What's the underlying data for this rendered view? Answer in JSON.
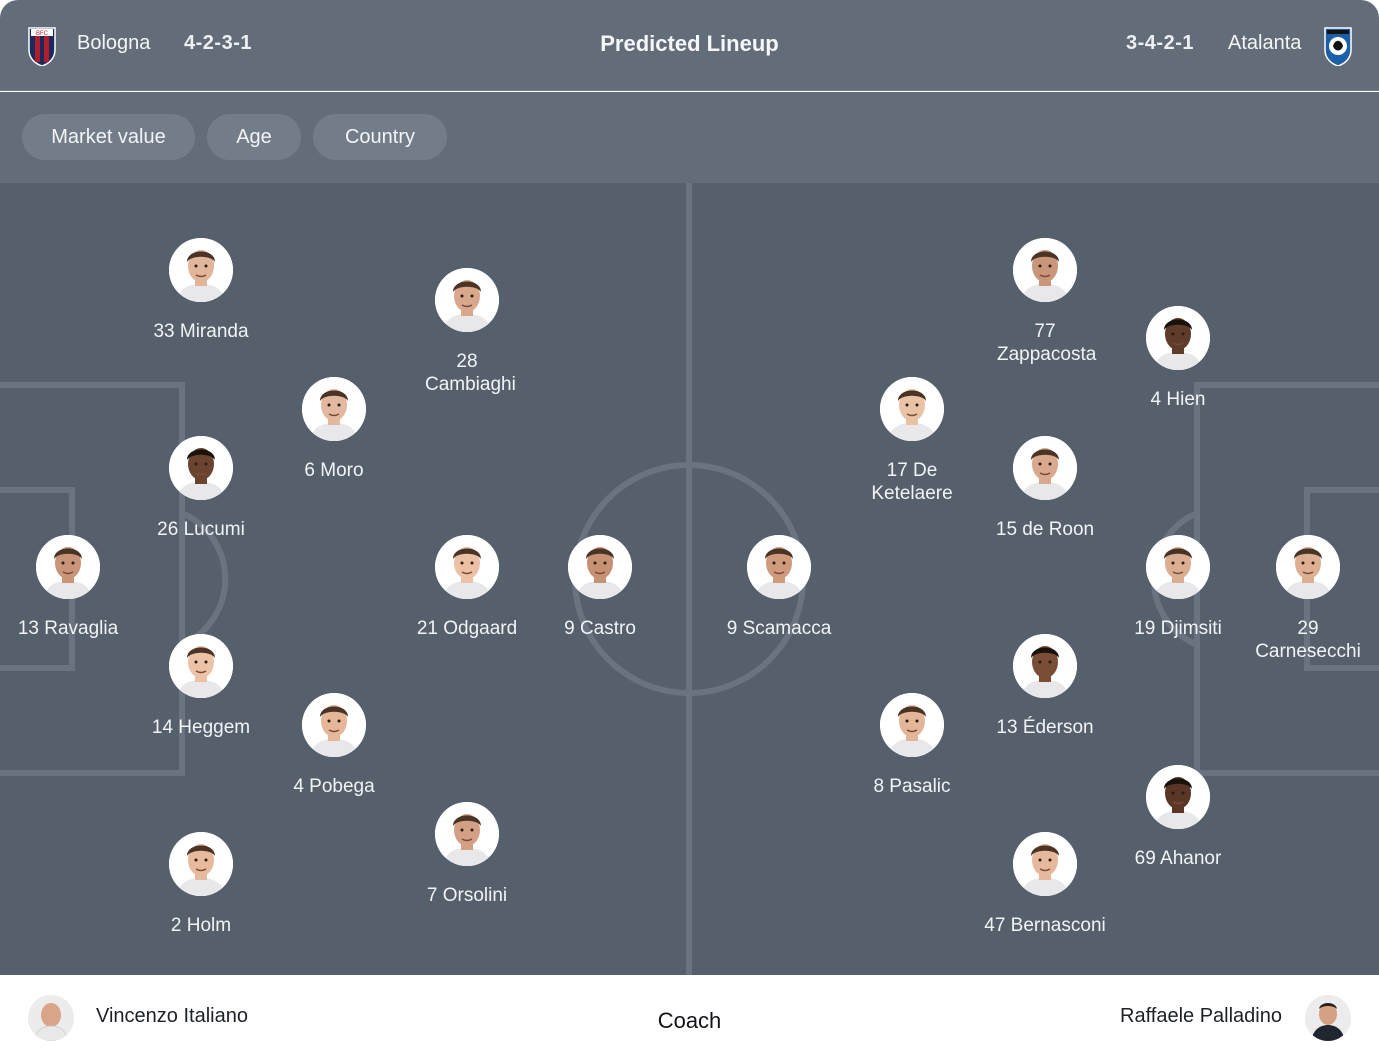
{
  "header": {
    "title": "Predicted Lineup",
    "home": {
      "name": "Bologna",
      "formation": "4-2-3-1",
      "badge_icon": "bologna-crest-icon",
      "badge_colors": [
        "#1a2a5c",
        "#b01e2e"
      ]
    },
    "away": {
      "name": "Atalanta",
      "formation": "3-4-2-1",
      "badge_icon": "atalanta-crest-icon",
      "badge_colors": [
        "#1b5fa8",
        "#111111"
      ]
    }
  },
  "filters": [
    "Market value",
    "Age",
    "Country"
  ],
  "home_players": [
    {
      "label": "33 Miranda",
      "skin": "#e0b59a"
    },
    {
      "label": "28 Cambiaghi",
      "skin": "#d9a88c"
    },
    {
      "label": "6 Moro",
      "skin": "#e2b99e"
    },
    {
      "label": "26 Lucumi",
      "skin": "#6b4430"
    },
    {
      "label": "13 Ravaglia",
      "skin": "#c99578"
    },
    {
      "label": "21 Odgaard",
      "skin": "#ecc0a4"
    },
    {
      "label": "9 Castro",
      "skin": "#c79173"
    },
    {
      "label": "14 Heggem",
      "skin": "#edc3a8"
    },
    {
      "label": "4 Pobega",
      "skin": "#e6b698"
    },
    {
      "label": "7 Orsolini",
      "skin": "#d3a084"
    },
    {
      "label": "2 Holm",
      "skin": "#e8ba9d"
    }
  ],
  "away_players": [
    {
      "label": "77 Zappacosta",
      "skin": "#c9967a"
    },
    {
      "label": "4 Hien",
      "skin": "#5e3b2a"
    },
    {
      "label": "17 De Ketelaere",
      "skin": "#eac2a6"
    },
    {
      "label": "15 de Roon",
      "skin": "#d8a98c"
    },
    {
      "label": "9 Scamacca",
      "skin": "#d09b7d"
    },
    {
      "label": "19 Djimsiti",
      "skin": "#dcae91"
    },
    {
      "label": "29 Carnesecchi",
      "skin": "#ddb093"
    },
    {
      "label": "13 Éderson",
      "skin": "#7a4e36"
    },
    {
      "label": "8 Pasalic",
      "skin": "#e3b69a"
    },
    {
      "label": "69 Ahanor",
      "skin": "#5a3626"
    },
    {
      "label": "47 Bernasconi",
      "skin": "#e7b99c"
    }
  ],
  "footer": {
    "label": "Coach",
    "home_coach": "Vincenzo Italiano",
    "away_coach": "Raffaele Palladino"
  },
  "colors": {
    "header_bg": "#636d79",
    "pitch_bg": "#56606c",
    "pitch_lines": "#6a7480",
    "chip_bg": "#737d89"
  }
}
